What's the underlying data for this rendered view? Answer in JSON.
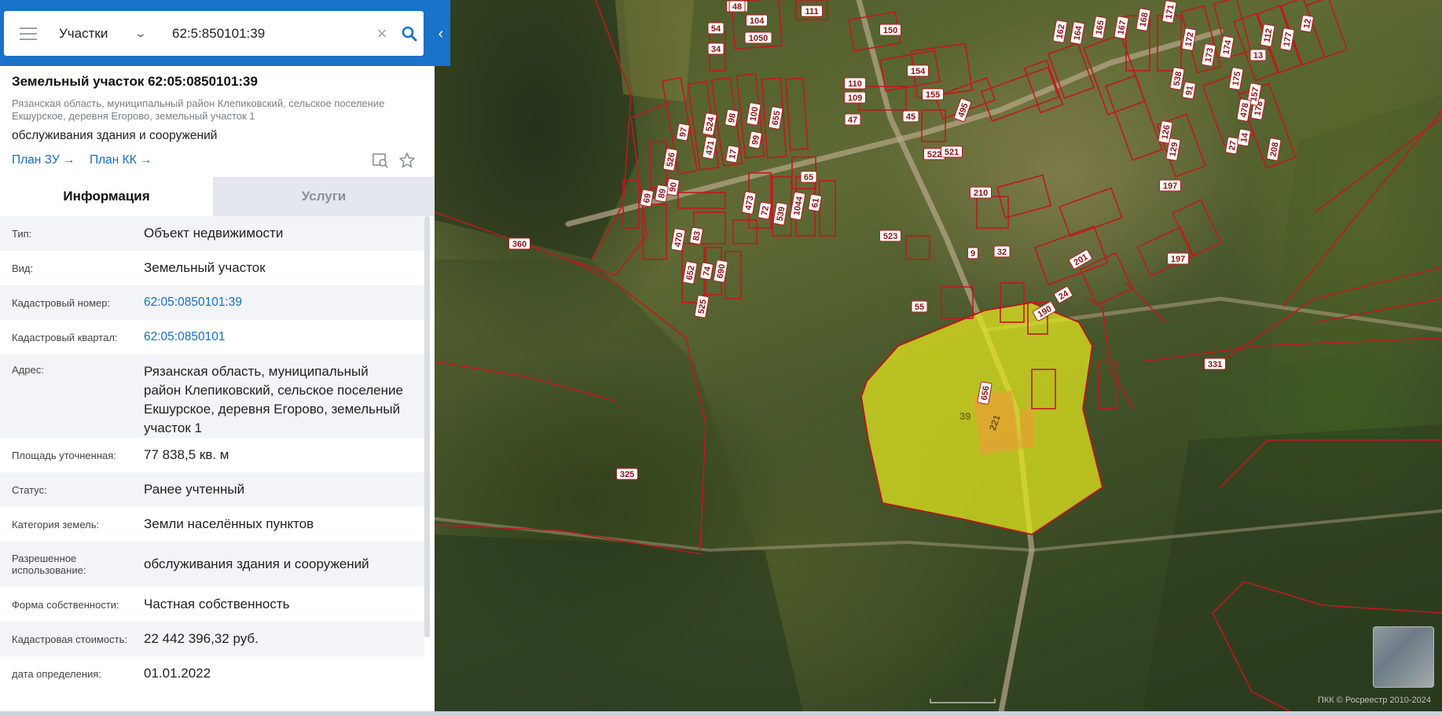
{
  "search": {
    "layer": "Участки",
    "query": "62:5:850101:39"
  },
  "object": {
    "title": "Земельный участок 62:05:0850101:39",
    "address": "Рязанская область, муниципальный район Клепиковский, сельское поселение Екшурское, деревня Егорово, земельный участок 1",
    "purpose": "обслуживания здания и сооружений",
    "links": {
      "plan_zu": "План ЗУ",
      "plan_kk": "План КК"
    }
  },
  "tabs": {
    "info": "Информация",
    "services": "Услуги"
  },
  "info_rows": [
    {
      "key": "Тип:",
      "value": "Объект недвижимости"
    },
    {
      "key": "Вид:",
      "value": "Земельный участок"
    },
    {
      "key": "Кадастровый номер:",
      "value": "62:05:0850101:39"
    },
    {
      "key": "Кадастровый квартал:",
      "value": "62:05:0850101"
    },
    {
      "key": "Адрес:",
      "value": "Рязанская область, муниципальный район Клепиковский, сельское поселение Екшурское, деревня Егорово, земельный участок 1"
    },
    {
      "key": "Площадь уточненная:",
      "value": "77 838,5 кв. м"
    },
    {
      "key": "Статус:",
      "value": "Ранее учтенный"
    },
    {
      "key": "Категория земель:",
      "value": "Земли населённых пунктов"
    },
    {
      "key": "Разрешенное использование:",
      "value": "обслуживания здания и сооружений"
    },
    {
      "key": "Форма собственности:",
      "value": "Частная собственность"
    },
    {
      "key": "Кадастровая стоимость:",
      "value": "22 442 396,32 руб."
    },
    {
      "key": "дата определения:",
      "value": "01.01.2022"
    }
  ],
  "map": {
    "selected_plot_label": "39",
    "building_label": "221",
    "plot_numbers": [
      "526",
      "104",
      "1050",
      "111",
      "54",
      "34",
      "150",
      "110",
      "109",
      "154",
      "155",
      "47",
      "45",
      "495",
      "97",
      "524",
      "98",
      "100",
      "655",
      "471",
      "17",
      "99",
      "65",
      "526",
      "90",
      "89",
      "69",
      "473",
      "72",
      "539",
      "1044",
      "61",
      "522",
      "521",
      "210",
      "470",
      "83",
      "523",
      "360",
      "652",
      "74",
      "690",
      "525",
      "9",
      "32",
      "201",
      "197",
      "197",
      "24",
      "190",
      "55",
      "656",
      "331",
      "325",
      "162",
      "164",
      "165",
      "167",
      "168",
      "171",
      "172",
      "173",
      "174",
      "175",
      "178",
      "208",
      "27",
      "14",
      "129",
      "126",
      "538",
      "91",
      "157",
      "13",
      "478",
      "177",
      "112",
      "12",
      "48"
    ],
    "attribution": "ПКК © Росреестр 2010-2024",
    "colors": {
      "selected_fill": "#e6ea1e",
      "boundary": "#c0191d",
      "header_blue": "#1a72c9",
      "link_blue": "#1a6dc6"
    }
  }
}
